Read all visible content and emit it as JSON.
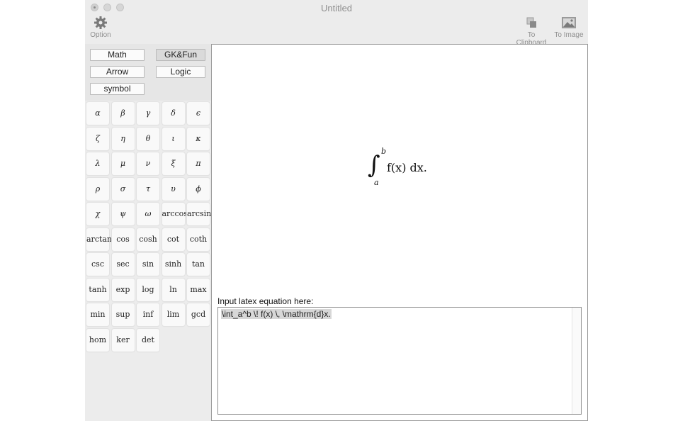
{
  "window": {
    "title": "Untitled"
  },
  "toolbar": {
    "option_label": "Option",
    "clipboard_label": "To Clipboard",
    "image_label": "To Image"
  },
  "categories": [
    "Math",
    "GK&Fun",
    "Arrow",
    "Logic",
    "symbol"
  ],
  "selected_category": "GK&Fun",
  "symbols": [
    "α",
    "β",
    "γ",
    "δ",
    "ϵ",
    "ζ",
    "η",
    "θ",
    "ι",
    "κ",
    "λ",
    "μ",
    "ν",
    "ξ",
    "π",
    "ρ",
    "σ",
    "τ",
    "υ",
    "ϕ",
    "χ",
    "ψ",
    "ω",
    "arccos",
    "arcsin",
    "arctan",
    "cos",
    "cosh",
    "cot",
    "coth",
    "csc",
    "sec",
    "sin",
    "sinh",
    "tan",
    "tanh",
    "exp",
    "log",
    "ln",
    "max",
    "min",
    "sup",
    "inf",
    "lim",
    "gcd",
    "hom",
    "ker",
    "det"
  ],
  "preview": {
    "upper": "b",
    "lower": "a",
    "body": "f(x) dx."
  },
  "editor": {
    "label": "Input latex equation here:",
    "value": "\\int_a^b \\! f(x) \\, \\mathrm{d}x."
  }
}
